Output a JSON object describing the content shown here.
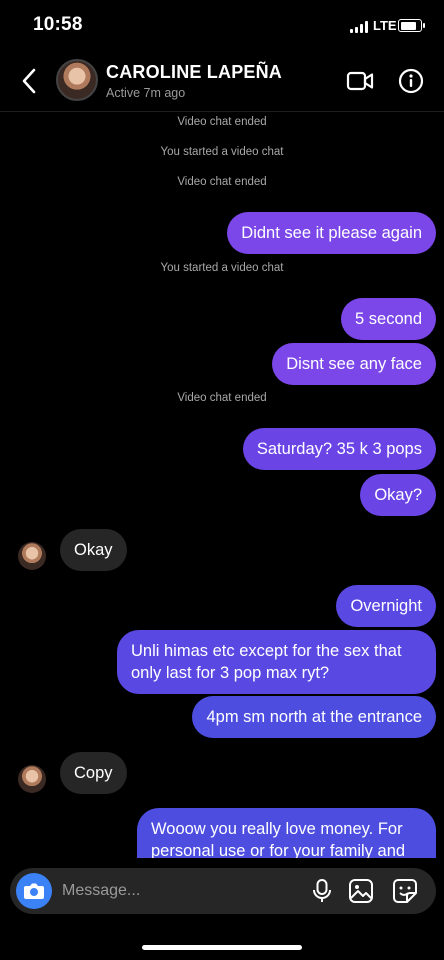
{
  "status_bar": {
    "time": "10:58",
    "network": "LTE",
    "battery_level": 0.85
  },
  "header": {
    "name": "CAROLINE LAPEÑA",
    "status": "Active 7m ago",
    "icons": {
      "back": "chevron-left-icon",
      "video": "video-call-icon",
      "info": "info-icon"
    }
  },
  "messages": [
    {
      "type": "system",
      "text": "Video chat ended"
    },
    {
      "type": "system",
      "text": "You started a video chat"
    },
    {
      "type": "system",
      "text": "Video chat ended"
    },
    {
      "type": "outgoing",
      "text": "Didnt see it please again"
    },
    {
      "type": "system",
      "text": "You started a video chat"
    },
    {
      "type": "outgoing",
      "text": "5 second"
    },
    {
      "type": "outgoing",
      "text": "Disnt see any face"
    },
    {
      "type": "system",
      "text": "Video chat ended"
    },
    {
      "type": "outgoing",
      "text": "Saturday? 35 k 3 pops"
    },
    {
      "type": "outgoing",
      "text": "Okay?"
    },
    {
      "type": "incoming",
      "text": "Okay"
    },
    {
      "type": "outgoing",
      "text": "Overnight"
    },
    {
      "type": "outgoing",
      "text": "Unli himas etc except for the sex that only last for 3 pop max ryt?"
    },
    {
      "type": "outgoing",
      "text": "4pm sm north at the entrance"
    },
    {
      "type": "incoming",
      "text": "Copy"
    },
    {
      "type": "outgoing",
      "text": "Wooow you really love money. For personal use or for your family and kid?"
    }
  ],
  "composer": {
    "placeholder": "Message..."
  },
  "colors": {
    "outgoing_top": "#7b47e9",
    "outgoing_bottom": "#4d4ee0",
    "incoming": "#262626",
    "camera": "#3b82f6"
  }
}
